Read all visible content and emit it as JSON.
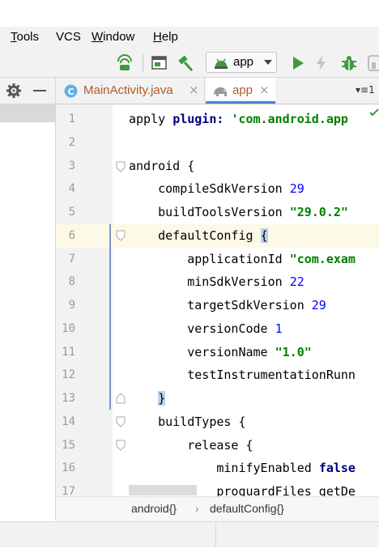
{
  "menu": {
    "items": [
      {
        "mnemonic": "T",
        "rest": "ools"
      },
      {
        "mnemonic": "",
        "rest": "VCS"
      },
      {
        "mnemonic": "W",
        "rest": "indow"
      },
      {
        "mnemonic": "H",
        "rest": "elp"
      }
    ]
  },
  "toolbar": {
    "run_config": "app",
    "icons": [
      "android-device-icon",
      "layout-inspector-icon",
      "build-hammer-icon",
      "run-icon",
      "apply-changes-icon",
      "debug-icon",
      "profile-icon"
    ]
  },
  "tabs": [
    {
      "label": "MainActivity.java",
      "close": "×",
      "icon": "C"
    },
    {
      "label": "app",
      "close": "×",
      "icon": "elephant"
    }
  ],
  "tab_overflow": "▾≡1",
  "editor": {
    "lines": [
      {
        "n": "1",
        "segs": [
          {
            "t": "apply "
          },
          {
            "t": "plugin:",
            "c": "kw"
          },
          {
            "t": " "
          },
          {
            "t": "'com.android.app",
            "c": "str"
          }
        ]
      },
      {
        "n": "2",
        "segs": []
      },
      {
        "n": "3",
        "segs": [
          {
            "t": "android {"
          }
        ]
      },
      {
        "n": "4",
        "segs": [
          {
            "t": "    compileSdkVersion "
          },
          {
            "t": "29",
            "c": "num"
          }
        ]
      },
      {
        "n": "5",
        "segs": [
          {
            "t": "    buildToolsVersion "
          },
          {
            "t": "\"29.0.2\"",
            "c": "str"
          }
        ]
      },
      {
        "n": "6",
        "segs": [
          {
            "t": "    defaultConfig "
          },
          {
            "t": "{",
            "c": "brace"
          }
        ]
      },
      {
        "n": "7",
        "segs": [
          {
            "t": "        applicationId "
          },
          {
            "t": "\"com.exam",
            "c": "str"
          }
        ]
      },
      {
        "n": "8",
        "segs": [
          {
            "t": "        minSdkVersion "
          },
          {
            "t": "22",
            "c": "num"
          }
        ]
      },
      {
        "n": "9",
        "segs": [
          {
            "t": "        targetSdkVersion "
          },
          {
            "t": "29",
            "c": "num"
          }
        ]
      },
      {
        "n": "10",
        "segs": [
          {
            "t": "        versionCode "
          },
          {
            "t": "1",
            "c": "num"
          }
        ]
      },
      {
        "n": "11",
        "segs": [
          {
            "t": "        versionName "
          },
          {
            "t": "\"1.0\"",
            "c": "str"
          }
        ]
      },
      {
        "n": "12",
        "segs": [
          {
            "t": "        testInstrumentationRunn"
          }
        ]
      },
      {
        "n": "13",
        "segs": [
          {
            "t": "    "
          },
          {
            "t": "}",
            "c": "brace"
          }
        ]
      },
      {
        "n": "14",
        "segs": [
          {
            "t": "    buildTypes {"
          }
        ]
      },
      {
        "n": "15",
        "segs": [
          {
            "t": "        release {"
          }
        ]
      },
      {
        "n": "16",
        "segs": [
          {
            "t": "            minifyEnabled "
          },
          {
            "t": "false",
            "c": "kw"
          }
        ]
      },
      {
        "n": "17",
        "segs": [
          {
            "t": "            proguardFiles getDe"
          }
        ]
      }
    ]
  },
  "breadcrumb": {
    "first": "android{}",
    "sep": "›",
    "second": "defaultConfig{}"
  },
  "colors": {
    "keyword": "#000080",
    "string": "#008000",
    "number": "#0000ff",
    "caret_line": "#fcf9e6",
    "brace_highlight": "#b8d2f2"
  }
}
